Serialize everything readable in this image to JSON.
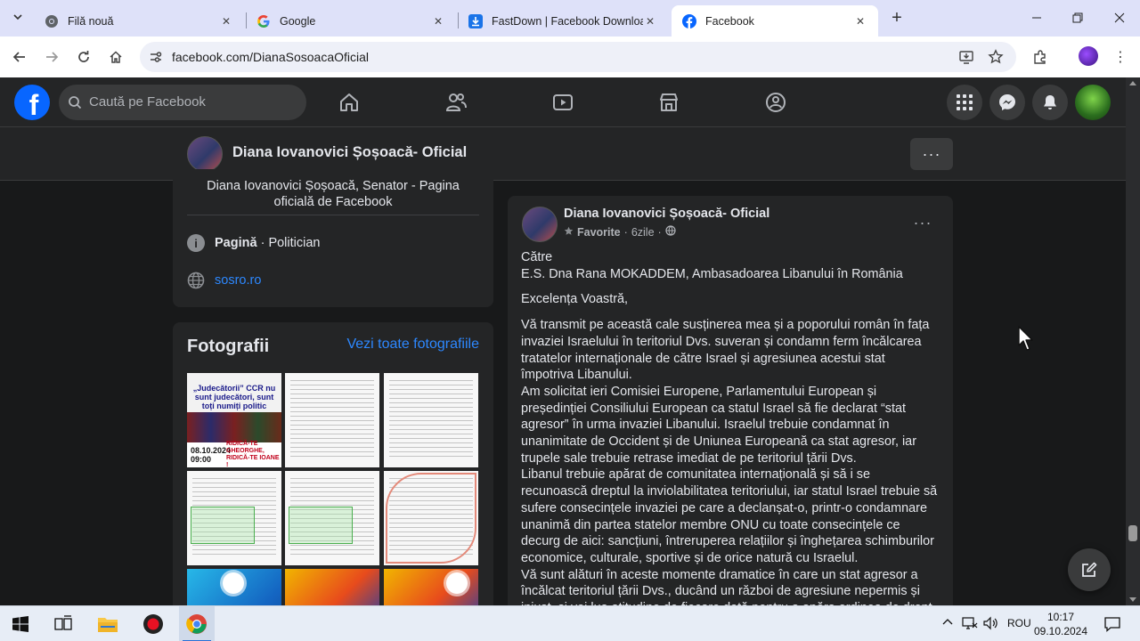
{
  "browser": {
    "tabs": [
      {
        "title": "Filă nouă",
        "icon": "chrome-newtab-icon",
        "active": false
      },
      {
        "title": "Google",
        "icon": "google-icon",
        "active": false
      },
      {
        "title": "FastDown | Facebook Downloader",
        "icon": "download-icon",
        "active": false
      },
      {
        "title": "Facebook",
        "icon": "facebook-icon",
        "active": true
      }
    ],
    "url": "facebook.com/DianaSosoacaOficial"
  },
  "fb_header": {
    "search_placeholder": "Caută pe Facebook",
    "brand_color": "#0866ff"
  },
  "page_bar": {
    "page_name": "Diana Iovanovici Șoșoacă- Oficial",
    "more_label": "···"
  },
  "intro": {
    "bio": "Diana Iovanovici Șoșoacă, Senator - Pagina oficială de Facebook",
    "category_label": "Pagină",
    "category_value": "Politician",
    "website": "sosro.ro"
  },
  "photos": {
    "title": "Fotografii",
    "see_all": "Vezi toate fotografiile",
    "photo1": {
      "title": "„Judecătorii” CCR nu sunt judecători, sunt toți numiți politic",
      "date": "08.10.2024 09:00",
      "caption": "RIDICĂ-TE GHEORGHE, RIDICĂ-TE IOANE !"
    }
  },
  "post": {
    "author": "Diana Iovanovici Șoșoacă- Oficial",
    "badge": "Favorite",
    "time": "6zile",
    "audience_icon": "globe-icon",
    "paragraphs": [
      "Către",
      "E.S. Dna Rana MOKADDEM, Ambasadoarea Libanului în România",
      "Excelența Voastră,",
      "Vă transmit pe această cale susținerea mea și a poporului român în fața invaziei Israelului în teritoriul Dvs. suveran și condamn ferm încălcarea tratatelor internaționale de către Israel și agresiunea acestui stat împotriva Libanului.",
      "Am solicitat ieri Comisiei Europene, Parlamentului European și președinției Consiliului European ca statul Israel să fie declarat “stat agresor” în urma invaziei Libanului. Israelul trebuie condamnat în unanimitate de Occident și de Uniunea Europeană ca stat agresor, iar trupele sale trebuie retrase imediat de pe teritoriul țării Dvs.",
      "Libanul trebuie apărat de comunitatea internațională și să i se recunoască dreptul la inviolabilitatea teritoriului, iar statul Israel trebuie să sufere consecințele invaziei pe care a declanșat-o, printr-o condamnare unanimă din partea statelor membre ONU cu toate consecințele ce decurg de aici: sancțiuni, întreruperea relațiilor și înghețarea schimburilor economice, culturale, sportive și de orice natură cu Israelul.",
      "Vă sunt alături în aceste momente dramatice în care un stat agresor a încălcat teritoriul țării Dvs., ducând un război de agresiune nepermis și injust, și voi lua atitudine de fiecare dată pentru a apăra ordinea de drept"
    ]
  },
  "taskbar": {
    "language": "ROU",
    "time": "10:17",
    "date": "09.10.2024"
  }
}
